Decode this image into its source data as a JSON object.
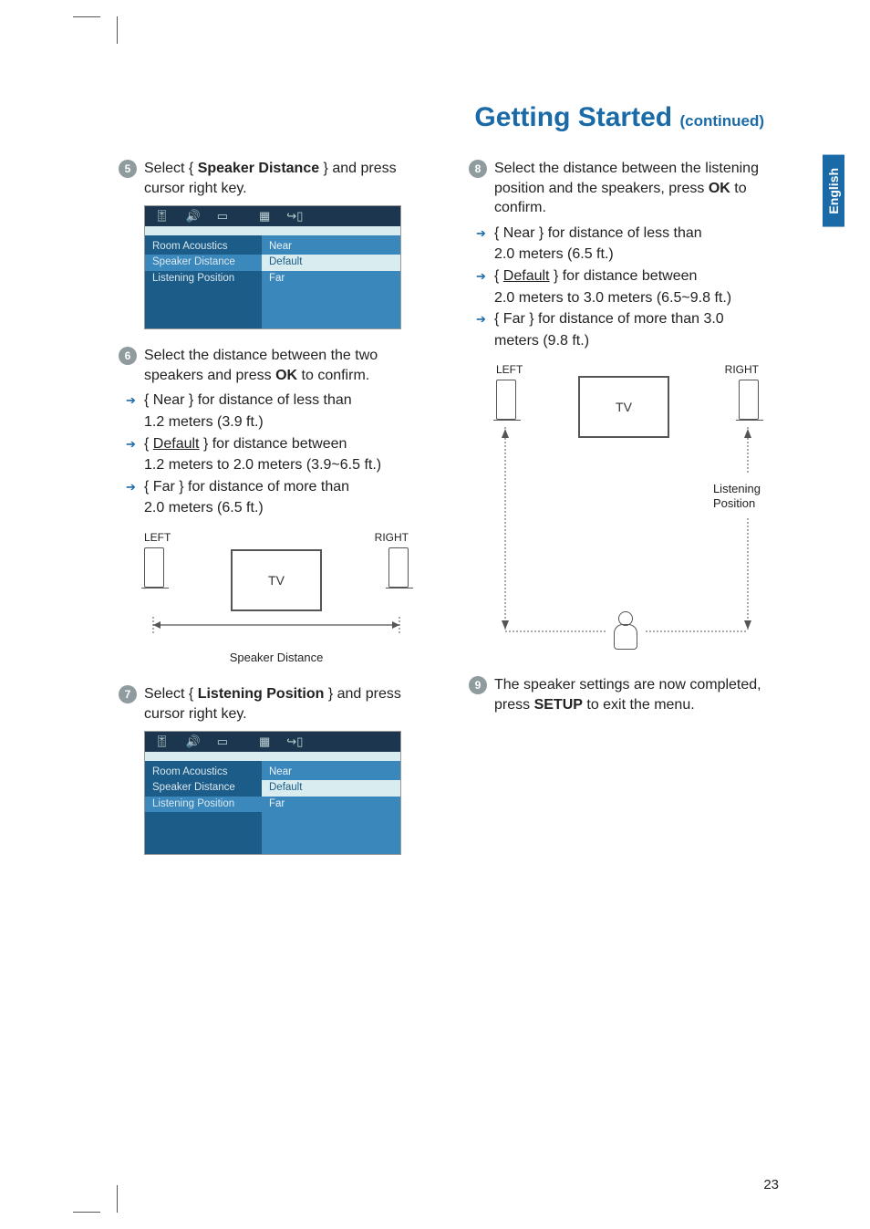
{
  "langTab": "English",
  "title": "Getting Started",
  "titleCont": "(continued)",
  "pageNumber": "23",
  "steps": {
    "s5": {
      "num": "5",
      "pre": "Select { ",
      "bold": "Speaker Distance",
      "post": " } and press cursor right key."
    },
    "s6": {
      "num": "6",
      "intro_a": "Select the distance between the two speakers and press ",
      "intro_bold": "OK",
      "intro_b": " to confirm.",
      "near": "{ Near } for distance of less than",
      "near2": "1.2 meters (3.9 ft.)",
      "def_a": "{ ",
      "def_u": "Default",
      "def_b": " } for distance between",
      "def2": "1.2 meters to 2.0 meters (3.9~6.5 ft.)",
      "far": "{ Far } for distance of more than",
      "far2": "2.0 meters (6.5 ft.)"
    },
    "s7": {
      "num": "7",
      "pre": "Select { ",
      "bold": "Listening Position",
      "post": " } and press cursor right key."
    },
    "s8": {
      "num": "8",
      "intro_a": "Select the distance between the listening position and the speakers, press ",
      "intro_bold": "OK",
      "intro_b": " to confirm.",
      "near": "{ Near } for distance of less than",
      "near2": "2.0 meters (6.5 ft.)",
      "def_a": "{ ",
      "def_u": "Default",
      "def_b": " } for distance between",
      "def2": "2.0 meters to 3.0 meters (6.5~9.8 ft.)",
      "far": "{ Far } for distance of more than 3.0",
      "far2": "meters (9.8 ft.)"
    },
    "s9": {
      "num": "9",
      "a": "The speaker settings are now completed, press ",
      "bold": "SETUP",
      "b": " to exit the menu."
    }
  },
  "menu1": {
    "left": [
      "Room Acoustics",
      "Speaker Distance",
      "Listening Position"
    ],
    "activeIndex": 1,
    "right": [
      "Near",
      "Default",
      "Far"
    ],
    "selectedIndex": 1
  },
  "menu2": {
    "left": [
      "Room Acoustics",
      "Speaker Distance",
      "Listening Position"
    ],
    "activeIndex": 2,
    "right": [
      "Near",
      "Default",
      "Far"
    ],
    "selectedIndex": 1
  },
  "diagram": {
    "left": "LEFT",
    "right": "RIGHT",
    "tv": "TV",
    "speakerDistance": "Speaker Distance",
    "listeningPosition1": "Listening",
    "listeningPosition2": "Position"
  }
}
